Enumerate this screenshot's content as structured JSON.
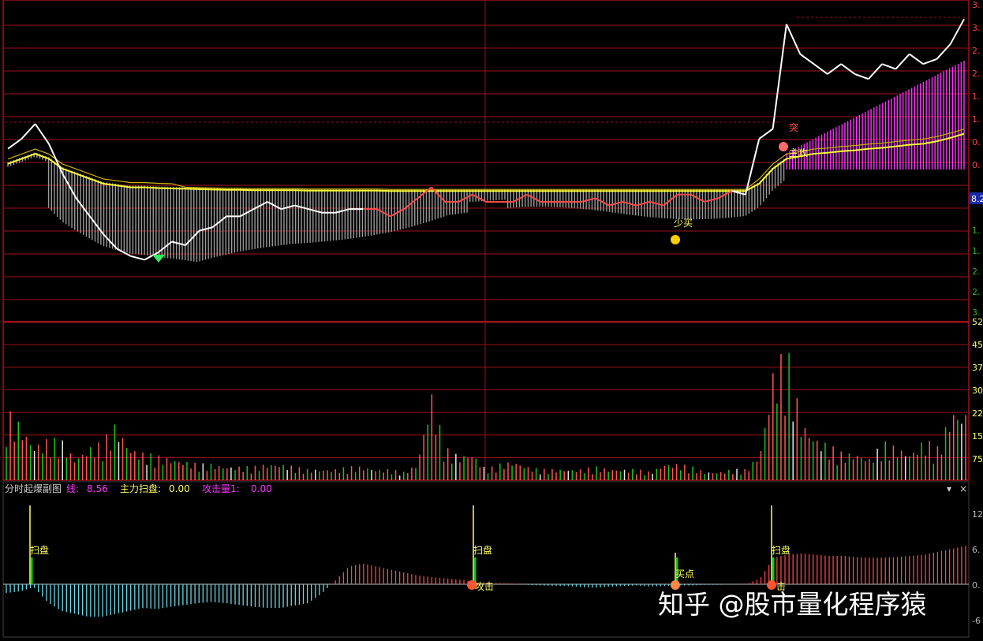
{
  "colors": {
    "background": "#000000",
    "grid": "#a0101a",
    "price_white": "#ffffff",
    "price_red": "#ff4a4a",
    "avg_yellow": "#ffff33",
    "avg_gold": "#cdb100",
    "bar_grey": "#9a9a9a",
    "bar_magenta": "#ff33ff",
    "vol_red": "#ff5555",
    "vol_green": "#18c418",
    "vol_white": "#e8e8e8",
    "osc_cyan": "#66d9e8",
    "osc_red": "#ff4444",
    "label_yellow": "#ffff66",
    "axis_red": "#ff4040"
  },
  "right_axis": {
    "price": [
      "3.",
      "3.",
      "2.",
      "2.",
      "1.",
      "1.",
      "0.",
      "0."
    ],
    "price_badge": "8.2",
    "price_lower": [
      "1.",
      "1.",
      "2.",
      "2.",
      "3."
    ],
    "volume": [
      "52",
      "45",
      "37",
      "30",
      "22",
      "15",
      "75"
    ],
    "osc": [
      "12",
      "6.",
      "0.",
      "-6"
    ]
  },
  "indicator_panel": {
    "title": "分时起爆副图",
    "items": [
      {
        "label": "线:",
        "value": "8.56",
        "color": "#ff33ff"
      },
      {
        "label": "主力扫盘:",
        "value": "0.00",
        "color": "#ffff66"
      },
      {
        "label": "攻击量1:",
        "value": "0.00",
        "color": "#ff33ff"
      }
    ],
    "controls": [
      "▾",
      "×"
    ]
  },
  "annotations": [
    {
      "text": "突",
      "color": "#ff4a4a"
    },
    {
      "text": "主攻",
      "color": "#ffff66"
    },
    {
      "text": "少买",
      "color": "#ffff66"
    },
    {
      "text": "扫盘",
      "color": "#ffff66"
    },
    {
      "text": "扫盘",
      "color": "#ffff66"
    },
    {
      "text": "扫盘",
      "color": "#ffff66"
    },
    {
      "text": "攻击",
      "color": "#ffff66"
    },
    {
      "text": "买点",
      "color": "#ffff66"
    },
    {
      "text": "击",
      "color": "#ffff66"
    }
  ],
  "watermark": "知乎 @股市量化程序猿",
  "chart_data": {
    "type": "line",
    "title": "",
    "xlabel": "",
    "ylabel": "",
    "series": [
      {
        "values": [
          0.7,
          0.9,
          1.2,
          0.8,
          0.2,
          -0.4,
          -0.9,
          -1.4,
          -1.8,
          -2.0,
          -2.1,
          -1.9,
          -1.6,
          -1.7,
          -1.3,
          -1.2,
          -0.9,
          -0.9,
          -0.7,
          -0.5,
          -0.7,
          -0.6,
          -0.7,
          -0.8,
          -0.8,
          -0.7,
          -0.7,
          -0.7,
          -0.9,
          -0.7,
          -0.4,
          -0.1,
          -0.5,
          -0.5,
          -0.3,
          -0.5,
          -0.5,
          -0.5,
          -0.3,
          -0.5,
          -0.5,
          -0.5,
          -0.5,
          -0.4,
          -0.6,
          -0.5,
          -0.6,
          -0.5,
          -0.6,
          -0.3,
          -0.3,
          -0.5,
          -0.4,
          -0.2,
          -0.3,
          0.9,
          1.1,
          3.2,
          2.6,
          2.4,
          2.2,
          2.4,
          2.2,
          2.1,
          2.4,
          2.3,
          2.6,
          2.4,
          2.5,
          2.8,
          3.3
        ]
      },
      {
        "values": [
          0.4,
          0.5,
          0.6,
          0.5,
          0.3,
          0.2,
          0.1,
          0.0,
          -0.05,
          -0.1,
          -0.1,
          -0.12,
          -0.13,
          -0.14,
          -0.15,
          -0.16,
          -0.17,
          -0.17,
          -0.18,
          -0.18,
          -0.18,
          -0.18,
          -0.19,
          -0.19,
          -0.19,
          -0.19,
          -0.19,
          -0.19,
          -0.2,
          -0.2,
          -0.2,
          -0.2,
          -0.2,
          -0.2,
          -0.2,
          -0.2,
          -0.2,
          -0.2,
          -0.2,
          -0.2,
          -0.2,
          -0.2,
          -0.2,
          -0.2,
          -0.2,
          -0.2,
          -0.2,
          -0.2,
          -0.2,
          -0.2,
          -0.2,
          -0.2,
          -0.2,
          -0.2,
          -0.2,
          0.0,
          0.3,
          0.5,
          0.55,
          0.6,
          0.62,
          0.65,
          0.67,
          0.7,
          0.72,
          0.75,
          0.78,
          0.8,
          0.85,
          0.92,
          1.0
        ]
      }
    ],
    "ylim": [
      -3.2,
      3.4
    ],
    "volume": [
      26,
      21,
      13,
      15,
      15,
      8,
      12,
      14,
      21,
      12,
      10,
      9,
      8,
      7,
      6,
      6,
      5,
      5,
      5,
      6,
      6,
      5,
      4,
      4,
      4,
      5,
      5,
      4,
      4,
      3,
      6,
      33,
      12,
      9,
      10,
      4,
      6,
      7,
      5,
      4,
      4,
      4,
      4,
      5,
      4,
      4,
      4,
      3,
      6,
      6,
      5,
      3,
      3,
      4,
      4,
      10,
      42,
      48,
      22,
      16,
      13,
      10,
      10,
      8,
      14,
      12,
      10,
      15,
      12,
      26,
      25
    ],
    "volume_ylim": [
      0,
      55
    ],
    "oscillator": [
      -1.5,
      -1.2,
      -0.5,
      -3.0,
      -4.5,
      -5.0,
      -5.5,
      -5.5,
      -5.0,
      -4.5,
      -4.0,
      -4.2,
      -3.8,
      -3.5,
      -3.2,
      -3.0,
      -3.2,
      -3.5,
      -3.8,
      -4.0,
      -4.0,
      -3.6,
      -3.2,
      -1.6,
      0.6,
      3.0,
      3.5,
      3.0,
      2.5,
      2.0,
      1.5,
      1.2,
      1.0,
      0.8,
      0.5,
      0.3,
      0.2,
      0.1,
      -0.1,
      -0.2,
      -0.3,
      -0.3,
      -0.5,
      -0.6,
      -0.4,
      -0.3,
      -0.2,
      -0.4,
      -0.3,
      -0.2,
      -0.2,
      -0.1,
      -0.1,
      0.0,
      0.0,
      1.0,
      4.5,
      5.0,
      5.2,
      5.0,
      4.8,
      4.8,
      4.6,
      4.5,
      4.5,
      4.6,
      4.8,
      5.0,
      5.5,
      6.0,
      6.5
    ],
    "osc_ylim": [
      -7,
      14
    ]
  }
}
